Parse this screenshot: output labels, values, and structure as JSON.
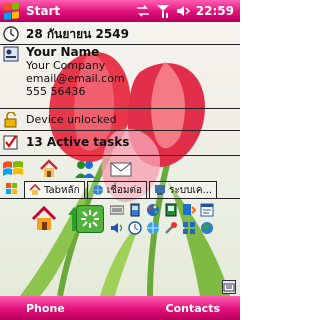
{
  "titlebar": {
    "title": "Start",
    "time": "22:59",
    "icons": [
      "windows-flag-icon",
      "connectivity-icon",
      "signal-icon",
      "speaker-icon"
    ]
  },
  "today": {
    "date": "28 กันยายน 2549",
    "owner": {
      "name": "Your Name",
      "company": "Your Company",
      "email": "email@email.com",
      "phone": "555 56436"
    },
    "lock_status": "Device unlocked",
    "tasks": "13 Active tasks"
  },
  "tabs": [
    {
      "label": "Tabหลัก",
      "icon": "home-icon"
    },
    {
      "label": "เชื่อมต่อ",
      "icon": "globe-icon"
    },
    {
      "label": "ระบบเค...",
      "icon": "system-icon"
    }
  ],
  "softkeys": {
    "left": "Phone",
    "right": "Contacts"
  },
  "colors": {
    "accent": "#e1107a",
    "accent_dark": "#b6005c",
    "accent_light": "#ff5fb2"
  }
}
